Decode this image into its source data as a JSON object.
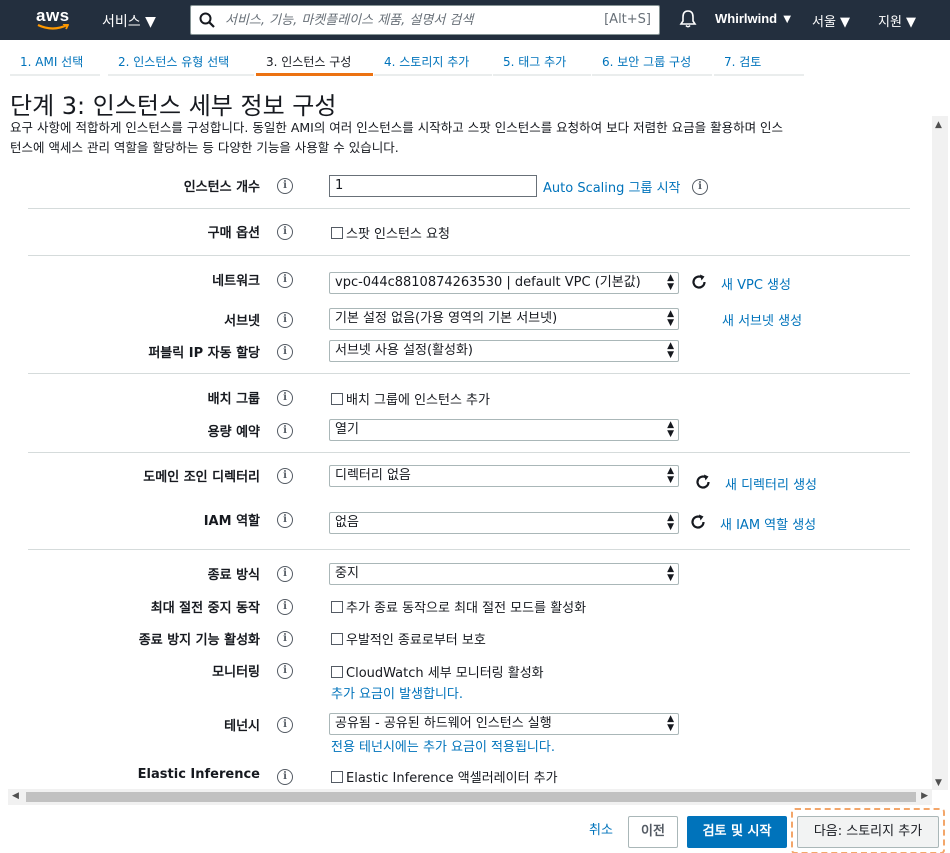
{
  "topnav": {
    "logo": "aws",
    "services": "서비스 ▼",
    "search_placeholder": "서비스, 기능, 마켓플레이스 제품, 설명서 검색",
    "search_shortcut": "[Alt+S]",
    "user": "Whirlwind ▼",
    "region": "서울 ▼",
    "support": "지원 ▼"
  },
  "tabs": [
    {
      "label": "1. AMI 선택"
    },
    {
      "label": "2. 인스턴스 유형 선택"
    },
    {
      "label": "3. 인스턴스 구성"
    },
    {
      "label": "4. 스토리지 추가"
    },
    {
      "label": "5. 태그 추가"
    },
    {
      "label": "6. 보안 그룹 구성"
    },
    {
      "label": "7. 검토"
    }
  ],
  "title": "단계 3: 인스턴스 세부 정보 구성",
  "description": {
    "line1": "요구 사항에 적합하게 인스턴스를 구성합니다. 동일한 AMI의 여러 인스턴스를 시작하고 스팟 인스턴스를 요청하여 보다 저렴한 요금을 활용하며 인스",
    "line2": "턴스에 액세스 관리 역할을 할당하는 등 다양한 기능을 사용할 수 있습니다."
  },
  "form": {
    "instance_count": {
      "label": "인스턴스 개수",
      "value": "1",
      "link": "Auto Scaling 그룹 시작"
    },
    "purchase_option": {
      "label": "구매 옵션",
      "checkbox": "스팟 인스턴스 요청"
    },
    "network": {
      "label": "네트워크",
      "value": "vpc-044c8810874263530 | default VPC (기본값)",
      "link": "새 VPC 생성"
    },
    "subnet": {
      "label": "서브넷",
      "value": "기본 설정 없음(가용 영역의 기본 서브넷)",
      "link": "새 서브넷 생성"
    },
    "public_ip": {
      "label": "퍼블릭 IP 자동 할당",
      "value": "서브넷 사용 설정(활성화)"
    },
    "placement_group": {
      "label": "배치 그룹",
      "checkbox": "배치 그룹에 인스턴스 추가"
    },
    "capacity_reservation": {
      "label": "용량 예약",
      "value": "열기"
    },
    "domain_join": {
      "label": "도메인 조인 디렉터리",
      "value": "디렉터리 없음",
      "link": "새 디렉터리 생성"
    },
    "iam_role": {
      "label": "IAM 역할",
      "value": "없음",
      "link": "새 IAM 역할 생성"
    },
    "shutdown_behavior": {
      "label": "종료 방식",
      "value": "중지"
    },
    "stop_hibernate": {
      "label": "최대 절전 중지 동작",
      "checkbox": "추가 종료 동작으로 최대 절전 모드를 활성화"
    },
    "termination_protection": {
      "label": "종료 방지 기능 활성화",
      "checkbox": "우발적인 종료로부터 보호"
    },
    "monitoring": {
      "label": "모니터링",
      "checkbox": "CloudWatch 세부 모니터링 활성화",
      "note": "추가 요금이 발생합니다."
    },
    "tenancy": {
      "label": "테넌시",
      "value": "공유됨 - 공유된 하드웨어 인스턴스 실행",
      "note": "전용 테넌시에는 추가 요금이 적용됩니다."
    },
    "elastic_inference": {
      "label": "Elastic Inference",
      "checkbox": "Elastic Inference 액셀러레이터 추가"
    }
  },
  "footer": {
    "cancel": "취소",
    "previous": "이전",
    "review_launch": "검토 및 시작",
    "next": "다음: 스토리지 추가"
  },
  "colors": {
    "nav_bg": "#232f3e",
    "link": "#0073bb",
    "primary_button": "#0073bb",
    "active_tab": "#ec7211"
  }
}
